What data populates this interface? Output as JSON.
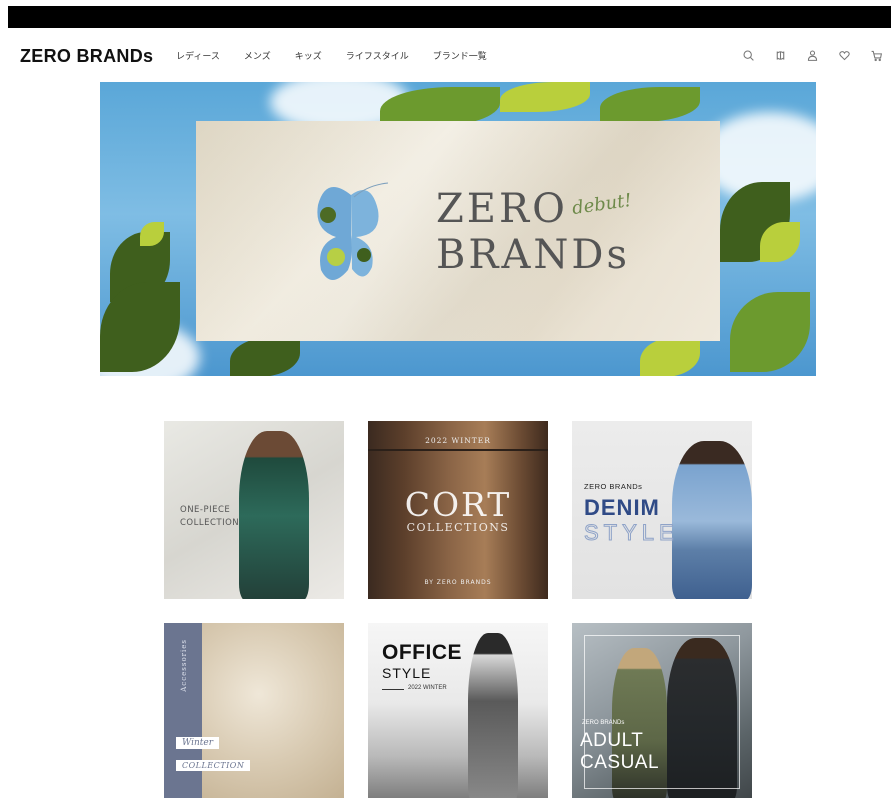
{
  "header": {
    "logo": "ZERO BRANDs",
    "nav": [
      "レディース",
      "メンズ",
      "キッズ",
      "ライフスタイル",
      "ブランド一覧"
    ],
    "icons": [
      "search-icon",
      "brand-icon",
      "user-icon",
      "heart-icon",
      "cart-icon"
    ]
  },
  "hero": {
    "title_line1": "ZERO",
    "title_line2": "BRANDs",
    "script": "debut!"
  },
  "tiles": {
    "onepiece": {
      "line1": "ONE-PIECE",
      "line2": "COLLECTION"
    },
    "cort": {
      "sub": "2022 WINTER",
      "title": "CORT",
      "coll": "COLLECTIONS",
      "by": "BY ZERO BRANDS"
    },
    "denim": {
      "brand": "ZERO BRANDs",
      "title": "DENIM",
      "style": "STYLE"
    },
    "accessories": {
      "vertical": "Accessories",
      "winter": "Winter",
      "coll": "COLLECTION"
    },
    "office": {
      "title": "OFFICE",
      "style": "STYLE",
      "date": "2022 WINTER"
    },
    "adult": {
      "brand": "ZERO BRANDs",
      "line1": "ADULT",
      "line2": "CASUAL"
    }
  },
  "colors": {
    "denim_blue": "#2f4a86",
    "accessories_bg": "#6b7590",
    "sky": "#5aa7d8"
  }
}
